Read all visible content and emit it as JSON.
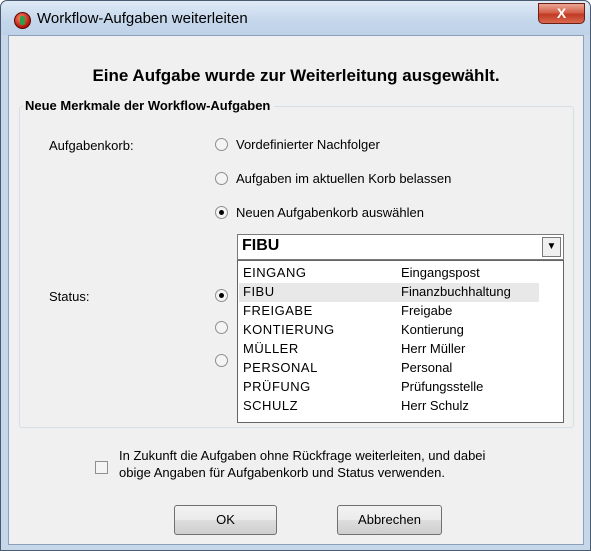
{
  "window": {
    "title": "Workflow-Aufgaben weiterleiten",
    "close_label": "X"
  },
  "heading": "Eine Aufgabe wurde zur Weiterleitung ausgewählt.",
  "group": {
    "legend": "Neue Merkmale der Workflow-Aufgaben"
  },
  "aufgabenkorb": {
    "label": "Aufgabenkorb:",
    "options": [
      "Vordefinierter Nachfolger",
      "Aufgaben im aktuellen Korb belassen",
      "Neuen Aufgabenkorb auswählen"
    ],
    "selected_index": 2
  },
  "status": {
    "label": "Status:"
  },
  "combo": {
    "value": "FIBU",
    "items": [
      {
        "code": "EINGANG",
        "desc": "Eingangspost"
      },
      {
        "code": "FIBU",
        "desc": "Finanzbuchhaltung"
      },
      {
        "code": "FREIGABE",
        "desc": "Freigabe"
      },
      {
        "code": "KONTIERUNG",
        "desc": "Kontierung"
      },
      {
        "code": "MÜLLER",
        "desc": "Herr Müller"
      },
      {
        "code": "PERSONAL",
        "desc": "Personal"
      },
      {
        "code": "PRÜFUNG",
        "desc": "Prüfungsstelle"
      },
      {
        "code": "SCHULZ",
        "desc": "Herr Schulz"
      }
    ],
    "highlighted_index": 1
  },
  "checkbox": {
    "line1": "In Zukunft die Aufgaben ohne Rückfrage weiterleiten, und dabei",
    "line2": "obige Angaben für Aufgabenkorb und Status verwenden.",
    "checked": false
  },
  "buttons": {
    "ok": "OK",
    "cancel": "Abbrechen"
  }
}
